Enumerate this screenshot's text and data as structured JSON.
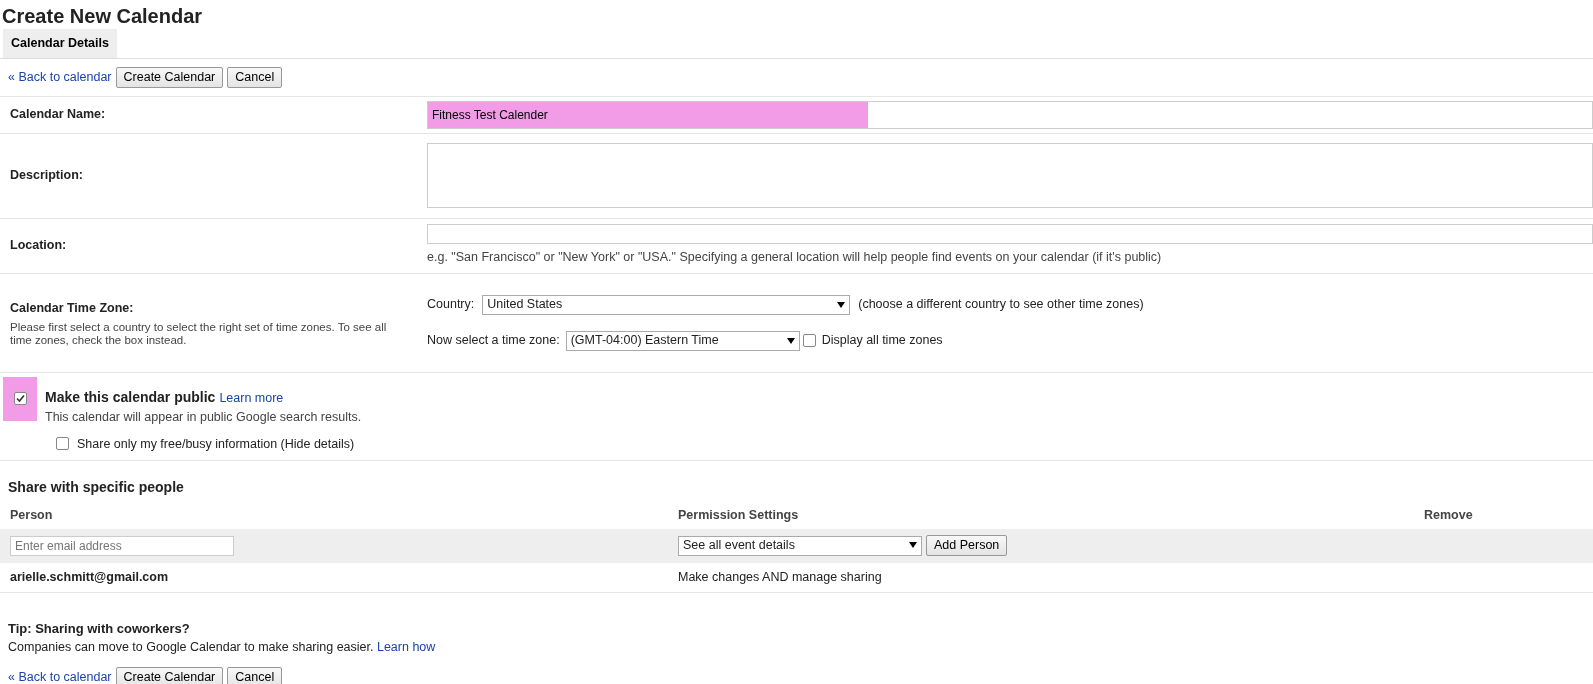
{
  "title": "Create New Calendar",
  "tabs": [
    {
      "label": "Calendar Details",
      "selected": true
    }
  ],
  "toolbar": {
    "back_link": "« Back to calendar",
    "create_button": "Create Calendar",
    "cancel_button": "Cancel"
  },
  "calendar_name": {
    "label": "Calendar Name:",
    "value": "Fitness Test Calender",
    "highlighted": true
  },
  "description": {
    "label": "Description:"
  },
  "location": {
    "label": "Location:",
    "hint": "e.g. \"San Francisco\" or \"New York\" or \"USA.\" Specifying a general location will help people find events on your calendar (if it's public)"
  },
  "time_zone": {
    "label": "Calendar Time Zone:",
    "help": "Please first select a country to select the right set of time zones. To see all time zones, check the box instead.",
    "country_label": "Country:",
    "country": "United States",
    "country_note": "(choose a different country to see other time zones)",
    "zone_label": "Now select a time zone:",
    "zone": "(GMT-04:00) Eastern Time",
    "display_all": {
      "label": "Display all time zones",
      "checked": false
    }
  },
  "public": {
    "checked": true,
    "highlighted": true,
    "label": "Make this calendar public",
    "learn_more": "Learn more",
    "note": "This calendar will appear in public Google search results.",
    "free_busy": {
      "label": "Share only my free/busy information (Hide details)",
      "checked": false
    }
  },
  "sharing": {
    "heading": "Share with specific people",
    "columns": [
      "Person",
      "Permission Settings",
      "Remove"
    ],
    "email_placeholder": "Enter email address",
    "permission": "See all event details",
    "add_button": "Add Person",
    "rows": [
      {
        "person": "arielle.schmitt@gmail.com",
        "permission": "Make changes AND manage sharing"
      }
    ]
  },
  "tip": {
    "heading": "Tip: Sharing with coworkers?",
    "text": "Companies can move to Google Calendar to make sharing easier.",
    "link": "Learn how"
  },
  "bottom_toolbar": {
    "back_link": "« Back to calendar",
    "create_button": "Create Calendar",
    "cancel_button": "Cancel"
  }
}
